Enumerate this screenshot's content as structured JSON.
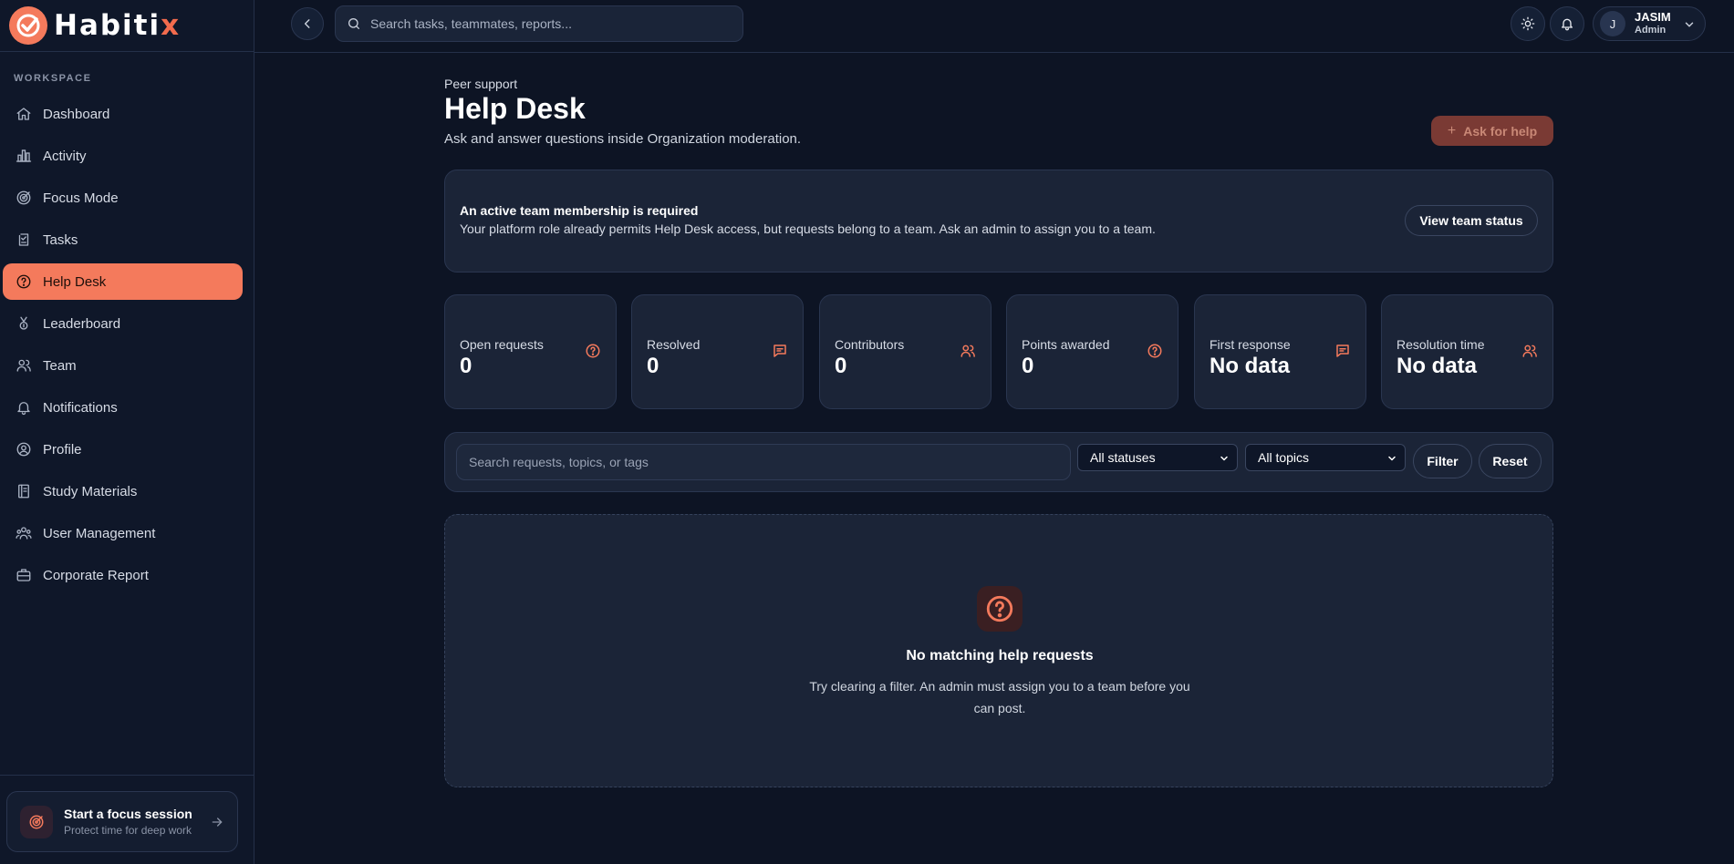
{
  "brand": {
    "name": "Habiti",
    "accent_letter": "x",
    "accent_color": "#f26b4d"
  },
  "sidebar": {
    "section_label": "WORKSPACE",
    "items": [
      {
        "label": "Dashboard",
        "icon": "home-icon"
      },
      {
        "label": "Activity",
        "icon": "bar-chart-icon"
      },
      {
        "label": "Focus Mode",
        "icon": "target-icon"
      },
      {
        "label": "Tasks",
        "icon": "clipboard-icon"
      },
      {
        "label": "Help Desk",
        "icon": "help-circle-icon",
        "active": true
      },
      {
        "label": "Leaderboard",
        "icon": "medal-icon"
      },
      {
        "label": "Team",
        "icon": "users-icon"
      },
      {
        "label": "Notifications",
        "icon": "bell-icon"
      },
      {
        "label": "Profile",
        "icon": "user-circle-icon"
      },
      {
        "label": "Study Materials",
        "icon": "book-icon"
      },
      {
        "label": "User Management",
        "icon": "user-group-icon"
      },
      {
        "label": "Corporate Report",
        "icon": "briefcase-icon"
      }
    ],
    "focus_card": {
      "title": "Start a focus session",
      "subtitle": "Protect time for deep work"
    }
  },
  "topbar": {
    "search_placeholder": "Search tasks, teammates, reports...",
    "user": {
      "initial": "J",
      "name": "JASIM",
      "role": "Admin"
    }
  },
  "page": {
    "eyebrow": "Peer support",
    "title": "Help Desk",
    "subtitle": "Ask and answer questions inside Organization moderation.",
    "ask_button": "Ask for help"
  },
  "alert": {
    "title": "An active team membership is required",
    "text": "Your platform role already permits Help Desk access, but requests belong to a team. Ask an admin to assign you to a team.",
    "button": "View team status"
  },
  "stats": [
    {
      "label": "Open requests",
      "value": "0",
      "icon": "help-circle-icon"
    },
    {
      "label": "Resolved",
      "value": "0",
      "icon": "message-icon"
    },
    {
      "label": "Contributors",
      "value": "0",
      "icon": "users-icon"
    },
    {
      "label": "Points awarded",
      "value": "0",
      "icon": "help-circle-icon"
    },
    {
      "label": "First response",
      "value": "No data",
      "icon": "message-icon"
    },
    {
      "label": "Resolution time",
      "value": "No data",
      "icon": "users-icon"
    }
  ],
  "filters": {
    "search_placeholder": "Search requests, topics, or tags",
    "status_select": "All statuses",
    "topic_select": "All topics",
    "filter_button": "Filter",
    "reset_button": "Reset"
  },
  "empty_state": {
    "title": "No matching help requests",
    "text": "Try clearing a filter. An admin must assign you to a team before you can post."
  },
  "colors": {
    "accent": "#f47a5c",
    "background": "#0d1424",
    "card": "#1b2437"
  }
}
